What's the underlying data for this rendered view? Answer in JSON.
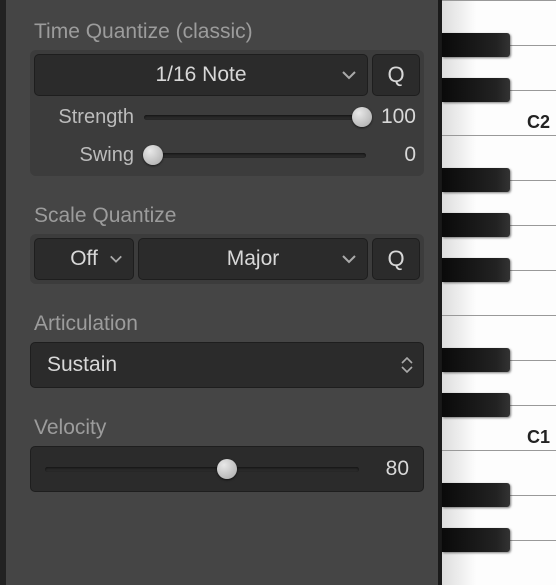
{
  "timeQuantize": {
    "title": "Time Quantize (classic)",
    "value": "1/16 Note",
    "qLabel": "Q",
    "strength": {
      "label": "Strength",
      "value": 100,
      "pct": 98
    },
    "swing": {
      "label": "Swing",
      "value": 0,
      "pct": 4
    }
  },
  "scaleQuantize": {
    "title": "Scale Quantize",
    "root": "Off",
    "mode": "Major",
    "qLabel": "Q"
  },
  "articulation": {
    "title": "Articulation",
    "value": "Sustain"
  },
  "velocity": {
    "title": "Velocity",
    "value": 80,
    "pct": 58
  },
  "piano": {
    "labels": {
      "c1": "C1",
      "c2": "C2"
    }
  }
}
